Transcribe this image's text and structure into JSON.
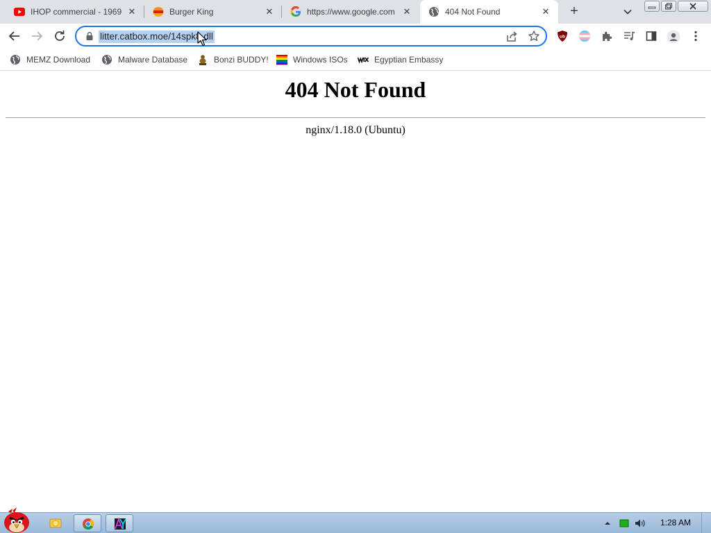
{
  "tabs": [
    {
      "title": "IHOP commercial - 1969",
      "favicon": "youtube-icon",
      "active": false
    },
    {
      "title": "Burger King",
      "favicon": "burger-king-icon",
      "active": false
    },
    {
      "title": "https://www.google.com",
      "favicon": "google-icon",
      "active": false
    },
    {
      "title": "404 Not Found",
      "favicon": "globe-icon",
      "active": true
    }
  ],
  "tab_close_glyph": "✕",
  "new_tab_glyph": "+",
  "address_bar": {
    "url": "litter.catbox.moe/14spk8.dll"
  },
  "bookmarks": [
    {
      "label": "MEMZ Download",
      "icon": "globe-icon"
    },
    {
      "label": "Malware Database",
      "icon": "globe-icon"
    },
    {
      "label": "Bonzi BUDDY!",
      "icon": "bonzi-icon"
    },
    {
      "label": "Windows ISOs",
      "icon": "rainbow-flag-icon"
    },
    {
      "label": "Egyptian Embassy",
      "icon": "wix-icon"
    }
  ],
  "page": {
    "heading": "404 Not Found",
    "server": "nginx/1.18.0 (Ubuntu)"
  },
  "taskbar": {
    "clock": "1:28 AM"
  },
  "colors": {
    "accent": "#1a73e8",
    "selection": "#b4d2f0",
    "tabstrip": "#dee1e6",
    "ublock": "#800000"
  }
}
